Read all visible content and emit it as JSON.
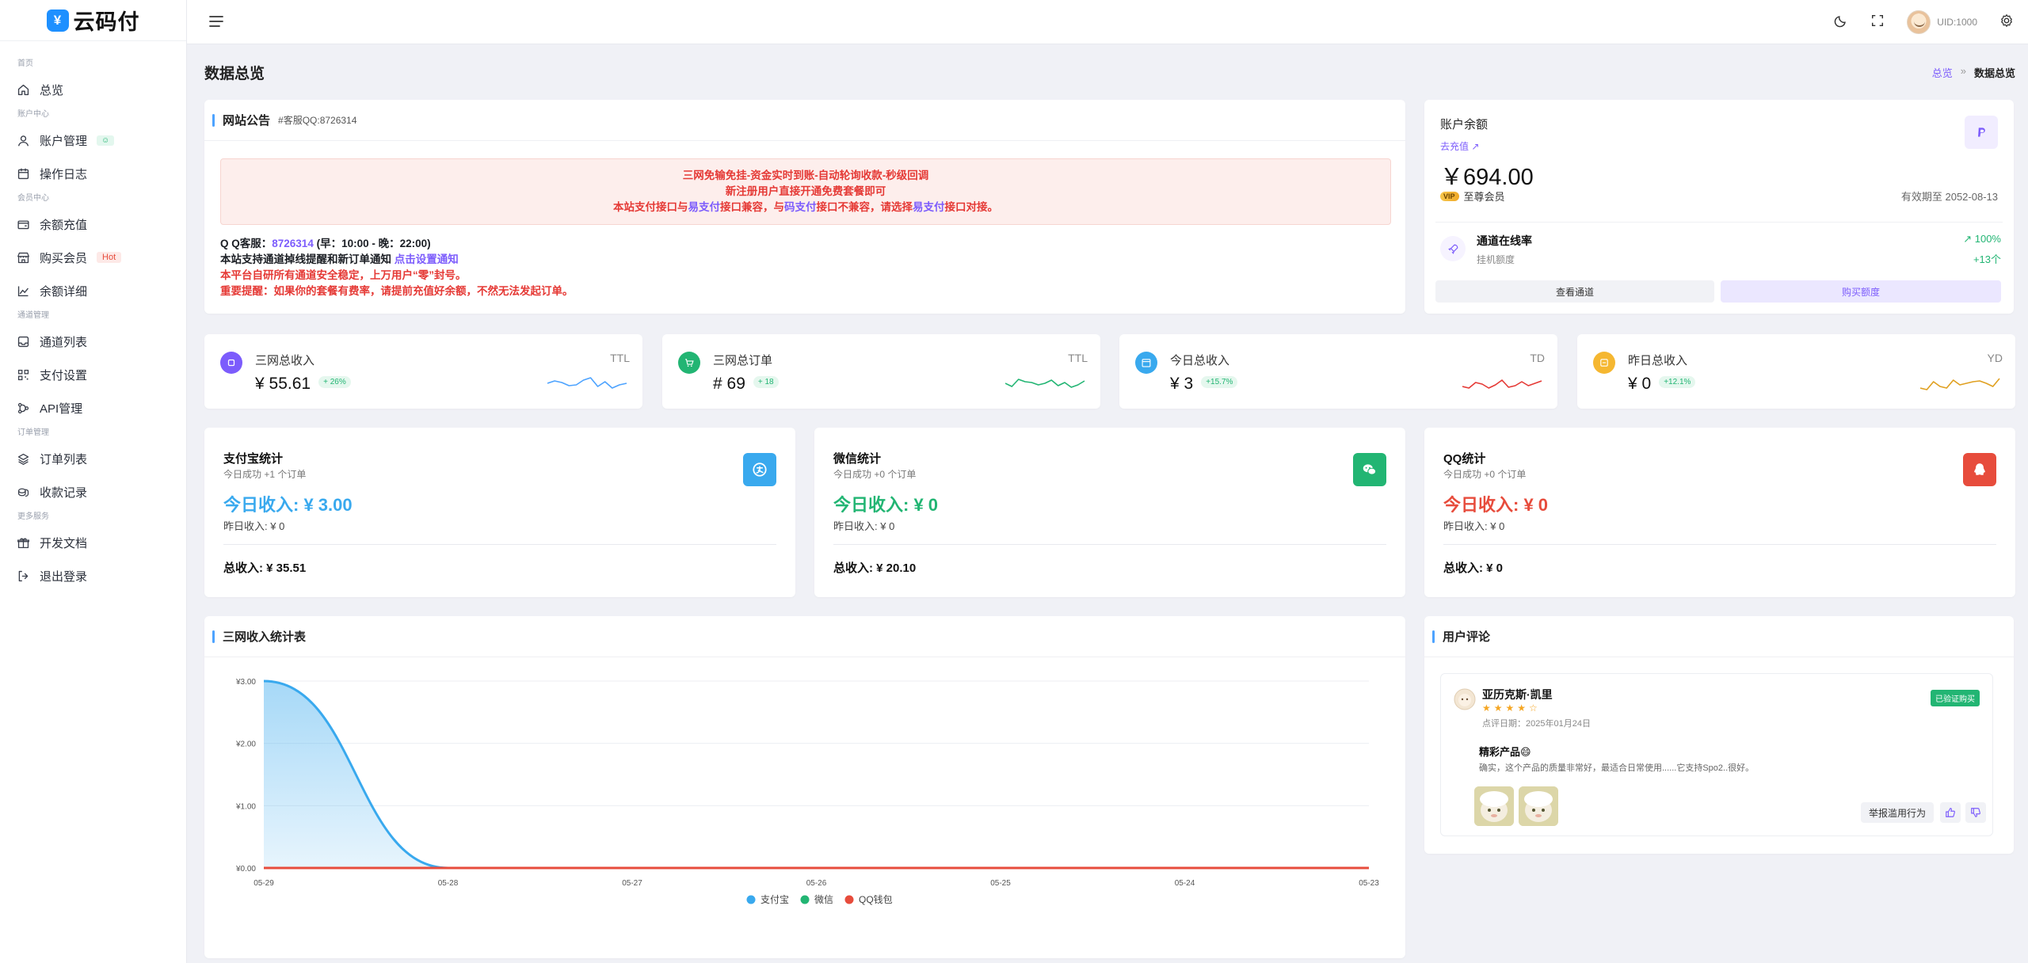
{
  "app": {
    "logo_text": "云码付",
    "logo_mark": "¥"
  },
  "sidebar": {
    "sections": [
      {
        "title": "首页",
        "items": [
          {
            "label": "总览",
            "icon": "home-icon"
          }
        ]
      },
      {
        "title": "账户中心",
        "items": [
          {
            "label": "账户管理",
            "icon": "user-icon",
            "badge": "☺"
          },
          {
            "label": "操作日志",
            "icon": "calendar-icon"
          }
        ]
      },
      {
        "title": "会员中心",
        "items": [
          {
            "label": "余额充值",
            "icon": "wallet-icon"
          },
          {
            "label": "购买会员",
            "icon": "store-icon",
            "badge": "Hot"
          },
          {
            "label": "余额详细",
            "icon": "chart-line-icon"
          }
        ]
      },
      {
        "title": "通道管理",
        "items": [
          {
            "label": "通道列表",
            "icon": "inbox-icon"
          },
          {
            "label": "支付设置",
            "icon": "qrcode-icon"
          },
          {
            "label": "API管理",
            "icon": "api-icon"
          }
        ]
      },
      {
        "title": "订单管理",
        "items": [
          {
            "label": "订单列表",
            "icon": "layers-icon"
          },
          {
            "label": "收款记录",
            "icon": "coins-icon"
          }
        ]
      },
      {
        "title": "更多服务",
        "items": [
          {
            "label": "开发文档",
            "icon": "gift-icon"
          },
          {
            "label": "退出登录",
            "icon": "logout-icon"
          }
        ]
      }
    ]
  },
  "topbar": {
    "user_id": "UID:1000"
  },
  "page": {
    "title": "数据总览",
    "breadcrumb": {
      "home": "总览",
      "sep": "»",
      "current": "数据总览"
    }
  },
  "notice": {
    "title": "网站公告",
    "subtitle": "#客服QQ:8726314",
    "box_line1": "三网免输免挂-资金实时到账-自动轮询收款-秒级回调",
    "box_line2": "新注册用户直接开通免费套餐即可",
    "box_line3_a": "本站支付接口与",
    "box_line3_b": "易支付",
    "box_line3_c": "接口兼容，与",
    "box_line3_d": "码支付",
    "box_line3_e": "接口不兼容，请选择",
    "box_line3_f": "易支付",
    "box_line3_g": "接口对接。",
    "qq_prefix": "Q Q客服：",
    "qq_number": "8726314",
    "qq_hours": " (早：10:00 - 晚：22:00)",
    "notify_text": "本站支持通道掉线提醒和新订单通知 ",
    "notify_link": "点击设置通知",
    "stable_text": "本平台自研所有通道安全稳定，上万用户“零”封号。",
    "warn_text": "重要提醒：如果你的套餐有费率，请提前充值好余额，不然无法发起订单。"
  },
  "balance": {
    "title": "账户余额",
    "recharge_link": "去充值",
    "amount": "￥694.00",
    "vip_badge": "VIP",
    "vip_level": "至尊会员",
    "expire": "有效期至 2052-08-13",
    "channel_title": "通道在线率",
    "channel_sub": "挂机额度",
    "channel_rate": "↗ 100%",
    "channel_count": "+13个",
    "view_button": "查看通道",
    "buy_button": "购买额度"
  },
  "stats": [
    {
      "label": "三网总收入",
      "value": "¥ 55.61",
      "badge": "+ 26%",
      "tag": "TTL",
      "color": "#7c5cfc",
      "line_color": "#4da3ff"
    },
    {
      "label": "三网总订单",
      "value": "# 69",
      "badge": "+ 18",
      "tag": "TTL",
      "color": "#22b573",
      "line_color": "#22b573"
    },
    {
      "label": "今日总收入",
      "value": "¥ 3",
      "badge": "+15.7%",
      "tag": "TD",
      "color": "#39a9ee",
      "line_color": "#e53935"
    },
    {
      "label": "昨日总收入",
      "value": "¥ 0",
      "badge": "+12.1%",
      "tag": "YD",
      "color": "#f5b731",
      "line_color": "#e0a020"
    }
  ],
  "payments": [
    {
      "title": "支付宝统计",
      "sub": "今日成功 +1 个订单",
      "today": "今日收入: ¥ 3.00",
      "yesterday": "昨日收入: ¥ 0",
      "total": "总收入: ¥ 35.51",
      "color": "#39a9ee",
      "icon": "alipay-icon"
    },
    {
      "title": "微信统计",
      "sub": "今日成功 +0 个订单",
      "today": "今日收入: ¥ 0",
      "yesterday": "昨日收入: ¥ 0",
      "total": "总收入: ¥ 20.10",
      "color": "#22b573",
      "icon": "wechat-icon"
    },
    {
      "title": "QQ统计",
      "sub": "今日成功 +0 个订单",
      "today": "今日收入: ¥ 0",
      "yesterday": "昨日收入: ¥ 0",
      "total": "总收入: ¥ 0",
      "color": "#e74c3c",
      "icon": "qq-icon"
    }
  ],
  "chart_title": "三网收入统计表",
  "chart_data": {
    "type": "area",
    "categories": [
      "05-29",
      "05-28",
      "05-27",
      "05-26",
      "05-25",
      "05-24",
      "05-23"
    ],
    "y_ticks": [
      "¥0.00",
      "¥1.00",
      "¥2.00",
      "¥3.00"
    ],
    "ylim": [
      0,
      3
    ],
    "series": [
      {
        "name": "支付宝",
        "values": [
          3,
          0,
          0,
          0,
          0,
          0,
          0
        ],
        "color": "#39a9ee"
      },
      {
        "name": "微信",
        "values": [
          0,
          0,
          0,
          0,
          0,
          0,
          0
        ],
        "color": "#22b573"
      },
      {
        "name": "QQ钱包",
        "values": [
          0,
          0,
          0,
          0,
          0,
          0,
          0
        ],
        "color": "#e74c3c"
      }
    ],
    "legend_position": "bottom",
    "grid": true
  },
  "reviews": {
    "title": "用户评论",
    "name": "亚历克斯·凯里",
    "stars": "★★★★☆",
    "date": "点评日期：2025年01月24日",
    "verified": "已验证购买",
    "headline": "精彩产品😄",
    "body": "确实，这个产品的质量非常好，最适合日常使用......它支持Spo2..很好。",
    "report": "举报滥用行为"
  }
}
